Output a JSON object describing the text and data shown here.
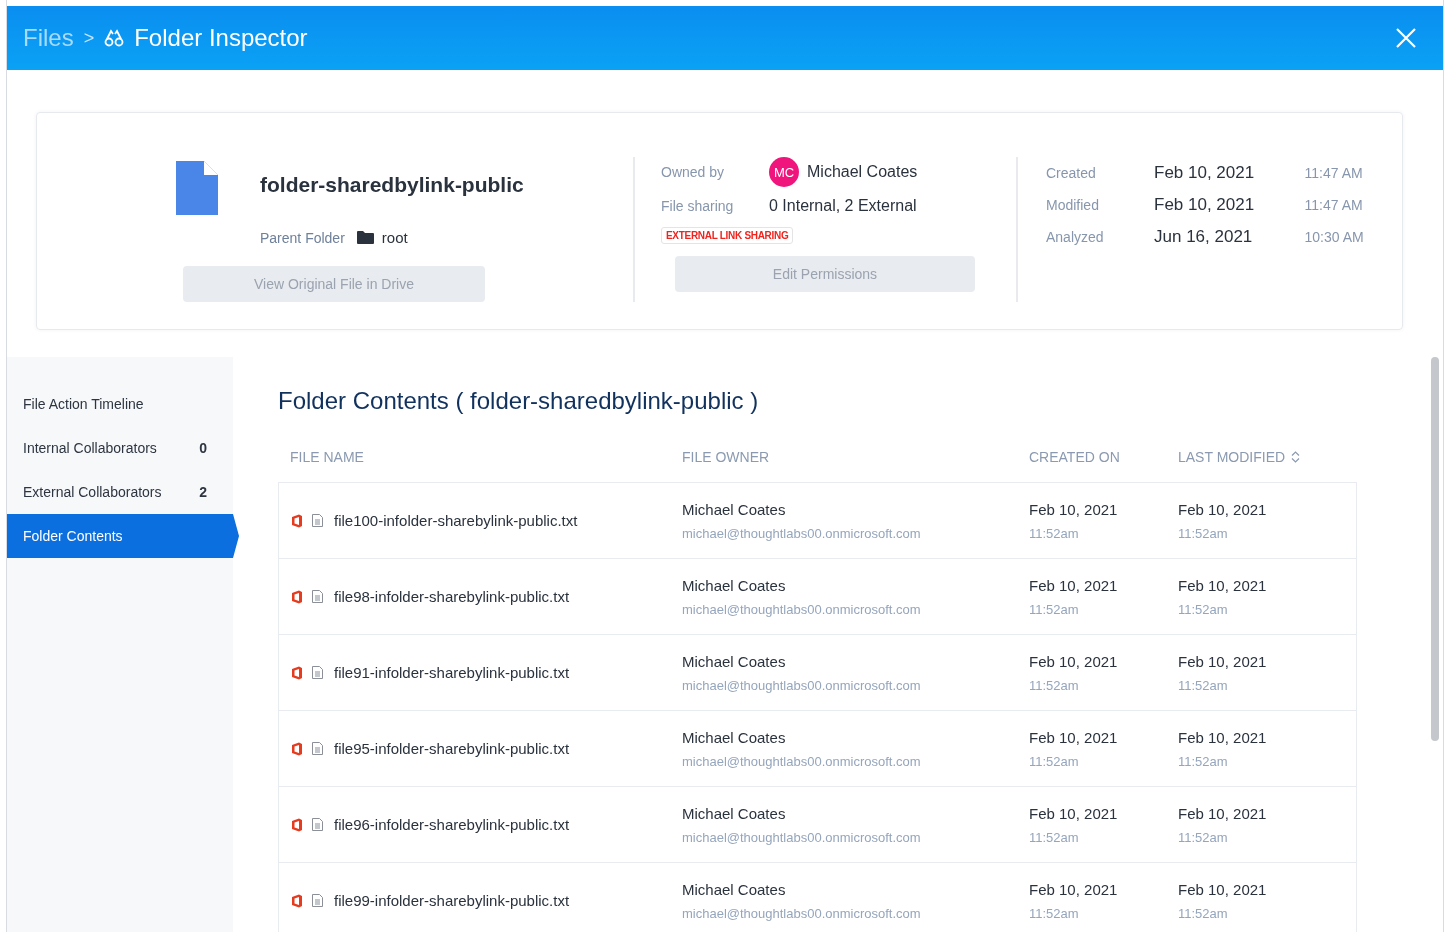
{
  "header": {
    "breadcrumb": "Files",
    "separator": ">",
    "title": "Folder Inspector"
  },
  "file": {
    "name": "folder-sharedbylink-public",
    "parent_label": "Parent Folder",
    "parent_value": "root",
    "button": {
      "label": "View Original File in Drive",
      "disabled": true
    }
  },
  "sharing": {
    "owner_label": "Owned by",
    "owner_initials": "MC",
    "owner_name": "Michael Coates",
    "sharing_label": "File sharing",
    "sharing_value": "0 Internal, 2 External",
    "tag": "EXTERNAL LINK SHARING",
    "button": {
      "label": "Edit Permissions",
      "disabled": true
    }
  },
  "dates": [
    {
      "label": "Created",
      "date": "Feb 10, 2021",
      "time": "11:47 AM"
    },
    {
      "label": "Modified",
      "date": "Feb 10, 2021",
      "time": "11:47 AM"
    },
    {
      "label": "Analyzed",
      "date": "Jun 16, 2021",
      "time": "10:30 AM"
    }
  ],
  "sidebar": {
    "items": [
      {
        "label": "File Action Timeline",
        "selected": false
      },
      {
        "label": "Internal Collaborators",
        "count": "0",
        "selected": false
      },
      {
        "label": "External Collaborators",
        "count": "2",
        "selected": false
      },
      {
        "label": "Folder Contents",
        "selected": true
      }
    ]
  },
  "contents": {
    "title": "Folder Contents ( folder-sharedbylink-public )",
    "columns": [
      {
        "label": "FILE NAME",
        "sortable": false
      },
      {
        "label": "FILE OWNER",
        "sortable": false
      },
      {
        "label": "CREATED ON",
        "sortable": false
      },
      {
        "label": "LAST MODIFIED",
        "sortable": true
      }
    ],
    "rows": [
      {
        "name": "file100-infolder-sharebylink-public.txt",
        "owner": "Michael Coates",
        "email": "michael@thoughtlabs00.onmicrosoft.com",
        "created_date": "Feb 10, 2021",
        "created_time": "11:52am",
        "modified_date": "Feb 10, 2021",
        "modified_time": "11:52am"
      },
      {
        "name": "file98-infolder-sharebylink-public.txt",
        "owner": "Michael Coates",
        "email": "michael@thoughtlabs00.onmicrosoft.com",
        "created_date": "Feb 10, 2021",
        "created_time": "11:52am",
        "modified_date": "Feb 10, 2021",
        "modified_time": "11:52am"
      },
      {
        "name": "file91-infolder-sharebylink-public.txt",
        "owner": "Michael Coates",
        "email": "michael@thoughtlabs00.onmicrosoft.com",
        "created_date": "Feb 10, 2021",
        "created_time": "11:52am",
        "modified_date": "Feb 10, 2021",
        "modified_time": "11:52am"
      },
      {
        "name": "file95-infolder-sharebylink-public.txt",
        "owner": "Michael Coates",
        "email": "michael@thoughtlabs00.onmicrosoft.com",
        "created_date": "Feb 10, 2021",
        "created_time": "11:52am",
        "modified_date": "Feb 10, 2021",
        "modified_time": "11:52am"
      },
      {
        "name": "file96-infolder-sharebylink-public.txt",
        "owner": "Michael Coates",
        "email": "michael@thoughtlabs00.onmicrosoft.com",
        "created_date": "Feb 10, 2021",
        "created_time": "11:52am",
        "modified_date": "Feb 10, 2021",
        "modified_time": "11:52am"
      },
      {
        "name": "file99-infolder-sharebylink-public.txt",
        "owner": "Michael Coates",
        "email": "michael@thoughtlabs00.onmicrosoft.com",
        "created_date": "Feb 10, 2021",
        "created_time": "11:52am",
        "modified_date": "Feb 10, 2021",
        "modified_time": "11:52am"
      }
    ]
  }
}
